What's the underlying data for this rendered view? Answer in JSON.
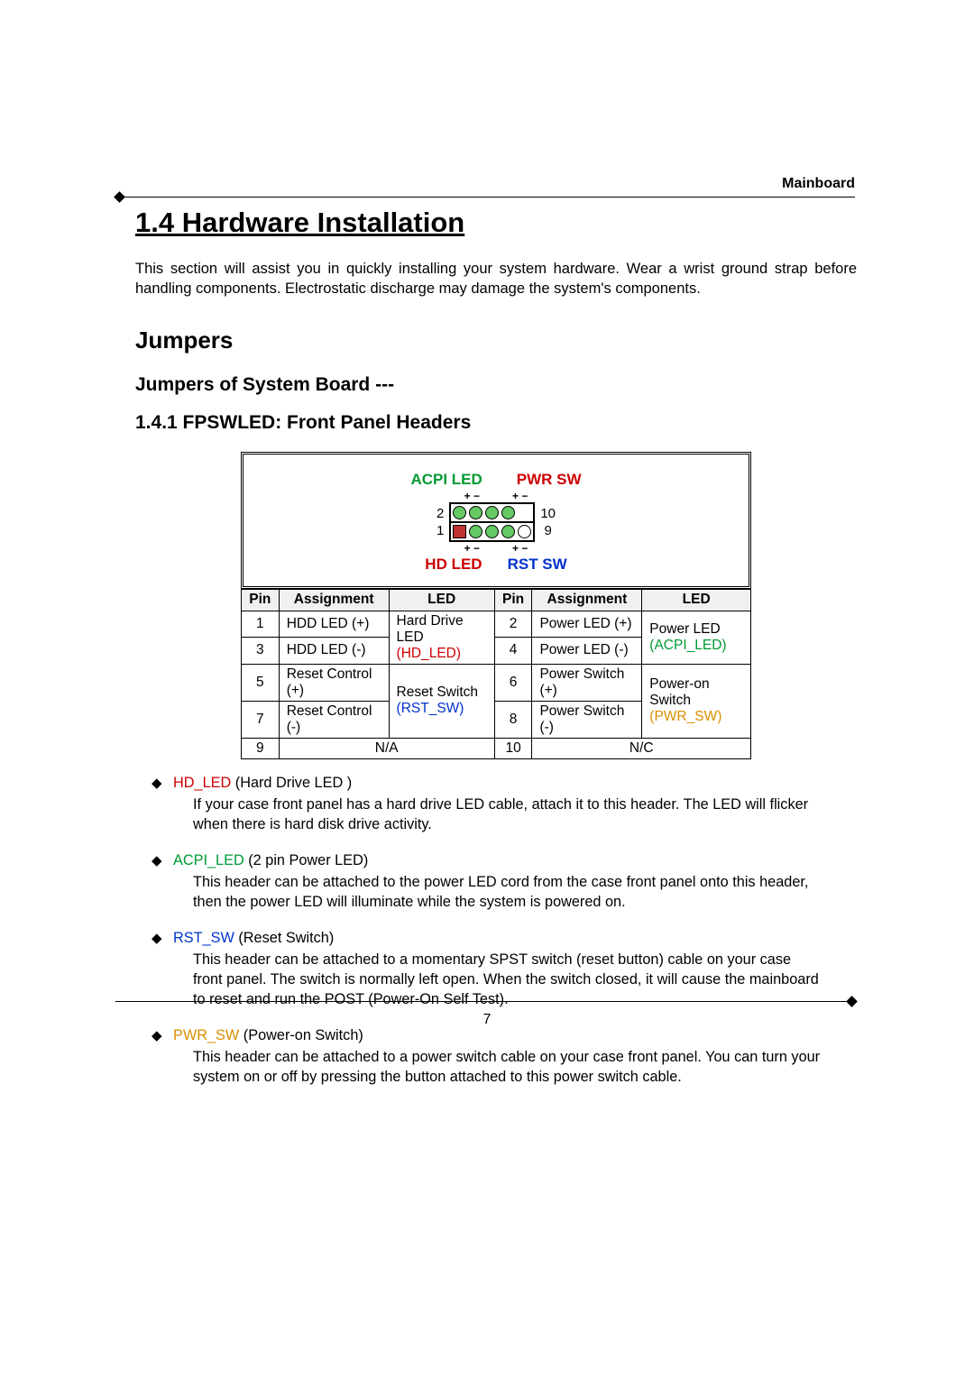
{
  "header": {
    "right": "Mainboard"
  },
  "title": "1.4 Hardware Installation",
  "intro": "This section will assist you in quickly installing your system hardware. Wear a wrist ground strap before handling components. Electrostatic discharge may damage the system's components.",
  "h2": "Jumpers",
  "h3": "Jumpers of System Board ---",
  "h4": "1.4.1 FPSWLED: Front Panel Headers",
  "diagram": {
    "acpi": "ACPI LED",
    "pwrsw": "PWR SW",
    "hdled": "HD LED",
    "rstsw": "RST SW",
    "pm1": "+  −",
    "pm2": "+  −",
    "pm3": "+  −",
    "pm4": "+  −",
    "num2": "2",
    "num1": "1",
    "num10": "10",
    "num9": "9"
  },
  "thead": {
    "pin": "Pin",
    "assign": "Assignment",
    "led": "LED"
  },
  "rows": [
    {
      "p1": "1",
      "a1": "HDD LED (+)",
      "l1a": "Hard Drive LED",
      "l1b": "(HD_LED)",
      "p2": "2",
      "a2": "Power LED (+)",
      "l2a": "Power LED",
      "l2b": "(ACPI_LED)"
    },
    {
      "p1": "3",
      "a1": "HDD LED (-)",
      "l1a": "",
      "l1b": "",
      "p2": "4",
      "a2": "Power LED (-)",
      "l2a": "",
      "l2b": ""
    },
    {
      "p1": "5",
      "a1": "Reset Control (+)",
      "l1a": "Reset Switch",
      "l1b": "(RST_SW)",
      "p2": "6",
      "a2": "Power Switch (+)",
      "l2a": "Power-on Switch",
      "l2b": "(PWR_SW)"
    },
    {
      "p1": "7",
      "a1": "Reset Control (-)",
      "l1a": "",
      "l1b": "",
      "p2": "8",
      "a2": "Power Switch (-)",
      "l2a": "",
      "l2b": ""
    },
    {
      "p1": "9",
      "a1": "N/A",
      "p2": "10",
      "a2": "N/C"
    }
  ],
  "notes": [
    {
      "code": "HD_LED",
      "codeClass": "code-red",
      "label": " (Hard Drive LED )",
      "body": "If your case front panel has a hard drive LED cable, attach it to this header. The LED will flicker when there is hard disk drive activity."
    },
    {
      "code": "ACPI_LED",
      "codeClass": "code-grn",
      "label": " (2 pin Power LED)",
      "body": "This header can be attached to the power LED cord from the case front panel onto this header, then the power LED will illuminate while the system is powered on."
    },
    {
      "code": "RST_SW",
      "codeClass": "code-blu",
      "label": " (Reset Switch)",
      "body": "This header can be attached to a momentary SPST switch (reset button) cable on your case front panel. The switch is normally left open. When the switch closed, it will cause the mainboard to reset and run the POST (Power-On Self Test)."
    },
    {
      "code": "PWR_SW",
      "codeClass": "code-yel",
      "label": " (Power-on Switch)",
      "body": "This header can be attached to a power switch cable on your case front panel. You can turn your system on or off by pressing the button attached to this power switch cable."
    }
  ],
  "pagenum": "7"
}
